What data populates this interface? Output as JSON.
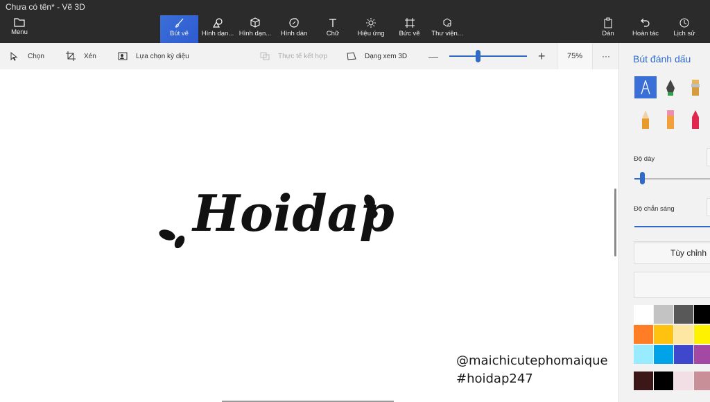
{
  "window": {
    "title": "Chưa có tên* - Vẽ 3D"
  },
  "ribbon": {
    "menu": "Menu",
    "tabs": [
      {
        "label": "Bút vẽ"
      },
      {
        "label": "Hình dạn..."
      },
      {
        "label": "Hình dạn..."
      },
      {
        "label": "Hình dán"
      },
      {
        "label": "Chữ"
      },
      {
        "label": "Hiệu ứng"
      },
      {
        "label": "Bức vẽ"
      },
      {
        "label": "Thư viện..."
      }
    ],
    "paste": "Dán",
    "undo": "Hoàn tác",
    "history": "Lịch sử"
  },
  "toolbar": {
    "select": "Chọn",
    "crop": "Xén",
    "magic_select": "Lựa chọn kỳ diệu",
    "mixed_reality": "Thực tế kết hợp",
    "view_3d": "Dạng xem 3D",
    "zoom": "75%",
    "more": "···"
  },
  "canvas": {
    "drawing_text": "Hoidap",
    "watermark1": "@maichicutephomaique",
    "watermark2": "#hoidap247"
  },
  "panel": {
    "title": "Bút đánh dấu",
    "thickness_label": "Độ dày",
    "opacity_label": "Độ chắn sáng",
    "customize": "Tùy chỉnh",
    "colors": [
      "#ffffff",
      "#c3c3c3",
      "#585858",
      "#000000",
      "#ff7e25",
      "#ffc20e",
      "#fde7a3",
      "#fff200",
      "#99ebff",
      "#00a2e8",
      "#3f48cc",
      "#a349a4",
      "#3b1717",
      "#000000",
      "#f2dfe6",
      "#c98f98"
    ]
  }
}
